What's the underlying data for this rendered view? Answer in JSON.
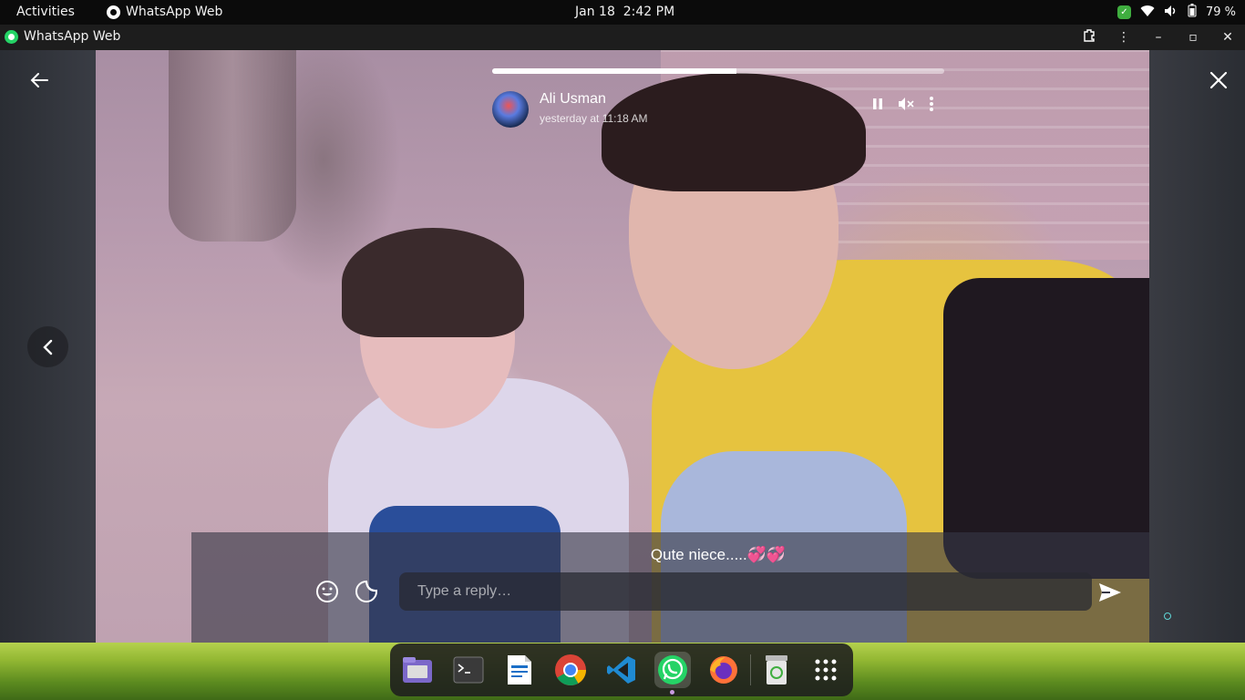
{
  "topbar": {
    "activities": "Activities",
    "app_indicator": "WhatsApp Web",
    "date": "Jan 18",
    "time": "2:42 PM",
    "battery": "79 %"
  },
  "window": {
    "title": "WhatsApp Web"
  },
  "status": {
    "author": "Ali Usman",
    "timestamp": "yesterday at 11:18 AM",
    "progress_fraction": 0.54,
    "caption": "Qute niece.....💞💞"
  },
  "reply": {
    "placeholder": "Type a reply…"
  },
  "dock": {
    "items": [
      "files-icon",
      "terminal-icon",
      "text-editor-icon",
      "chrome-icon",
      "vscode-icon",
      "whatsapp-icon",
      "firefox-icon",
      "trash-icon",
      "app-grid-icon"
    ],
    "active": "whatsapp-icon"
  },
  "colors": {
    "whatsapp_green": "#25d366",
    "hoodie_yellow": "#e6c33f",
    "overlay": "#373746"
  }
}
